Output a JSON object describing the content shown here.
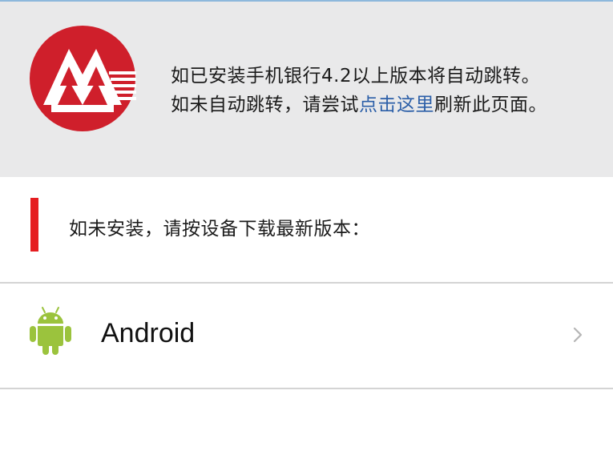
{
  "colors": {
    "header_bg": "#e9e9ea",
    "brand_red": "#cf1f2b",
    "accent_red_bar": "#e51d20",
    "link_blue": "#2c5fa8",
    "android_green": "#9bc33d",
    "divider": "#d4d4d4",
    "chevron": "#b5b5b5"
  },
  "header": {
    "logo_icon": "bank-logo-icon",
    "line1": "如已安装手机银行4.2以上版本将自动跳转。",
    "line2_before": "如未自动跳转，请尝试",
    "line2_link": "点击这里",
    "line2_after": "刷新此页面。"
  },
  "section": {
    "title": "如未安装，请按设备下载最新版本："
  },
  "downloads": [
    {
      "icon": "android-icon",
      "label": "Android",
      "chevron_icon": "chevron-right-icon"
    }
  ]
}
